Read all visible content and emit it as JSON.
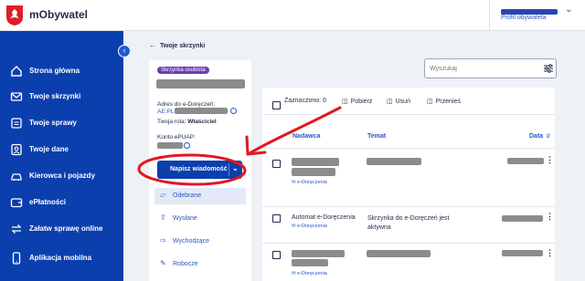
{
  "app": {
    "name": "mObywatel"
  },
  "profile": {
    "role_label": "Profil obywatela"
  },
  "sidebar": {
    "collapse_icon": "chevron-left-icon",
    "items": [
      {
        "label": "Strona główna",
        "icon": "home-icon"
      },
      {
        "label": "Twoje skrzynki",
        "icon": "mail-icon"
      },
      {
        "label": "Twoje sprawy",
        "icon": "folder-icon"
      },
      {
        "label": "Twoje dane",
        "icon": "id-card-icon"
      },
      {
        "label": "Kierowca i pojazdy",
        "icon": "car-icon"
      },
      {
        "label": "ePłatności",
        "icon": "wallet-icon"
      },
      {
        "label": "Załatw sprawę online",
        "icon": "arrows-icon"
      },
      {
        "label": "Aplikacja mobilna",
        "icon": "phone-icon"
      }
    ]
  },
  "back_link": {
    "label": "Twoje skrzynki"
  },
  "mailbox": {
    "badge": "Skrzynka osobista",
    "address_label": "Adres do e-Doręczeń:",
    "address_prefix": "AE:PL-",
    "role_label": "Twoja rola:",
    "role_value": "Właściciel",
    "epuap_label": "Konto ePUAP:",
    "write_button": "Napisz wiadomość",
    "folders": [
      {
        "label": "Odebrane",
        "icon": "inbox-icon",
        "active": true
      },
      {
        "label": "Wysłane",
        "icon": "upload-icon",
        "active": false
      },
      {
        "label": "Wychodzące",
        "icon": "outbox-icon",
        "active": false
      },
      {
        "label": "Robocze",
        "icon": "pencil-icon",
        "active": false
      }
    ]
  },
  "search": {
    "placeholder": "Wyszukaj",
    "filter_icon": "sliders-icon"
  },
  "toolbar": {
    "selected": "Zaznaczono: 0",
    "download": "Pobierz",
    "delete": "Usuń",
    "move": "Przenieś"
  },
  "columns": {
    "sender": "Nadawca",
    "subject": "Temat",
    "date": "Data"
  },
  "messages": [
    {
      "sender": "",
      "tag": "e-Doręczenia",
      "subject": "",
      "date": ""
    },
    {
      "sender": "Automat e-Doręczenia",
      "tag": "e-Doręczenia",
      "subject": "Skrzynka do e-Doręczeń jest aktywna",
      "date": ""
    },
    {
      "sender": "",
      "tag": "e-Doręczenia",
      "subject": "",
      "date": ""
    }
  ],
  "colors": {
    "brand_blue": "#0b3fae",
    "link_blue": "#2856c7",
    "badge_purple": "#6a3fb6",
    "annotation_red": "#e0191f"
  }
}
